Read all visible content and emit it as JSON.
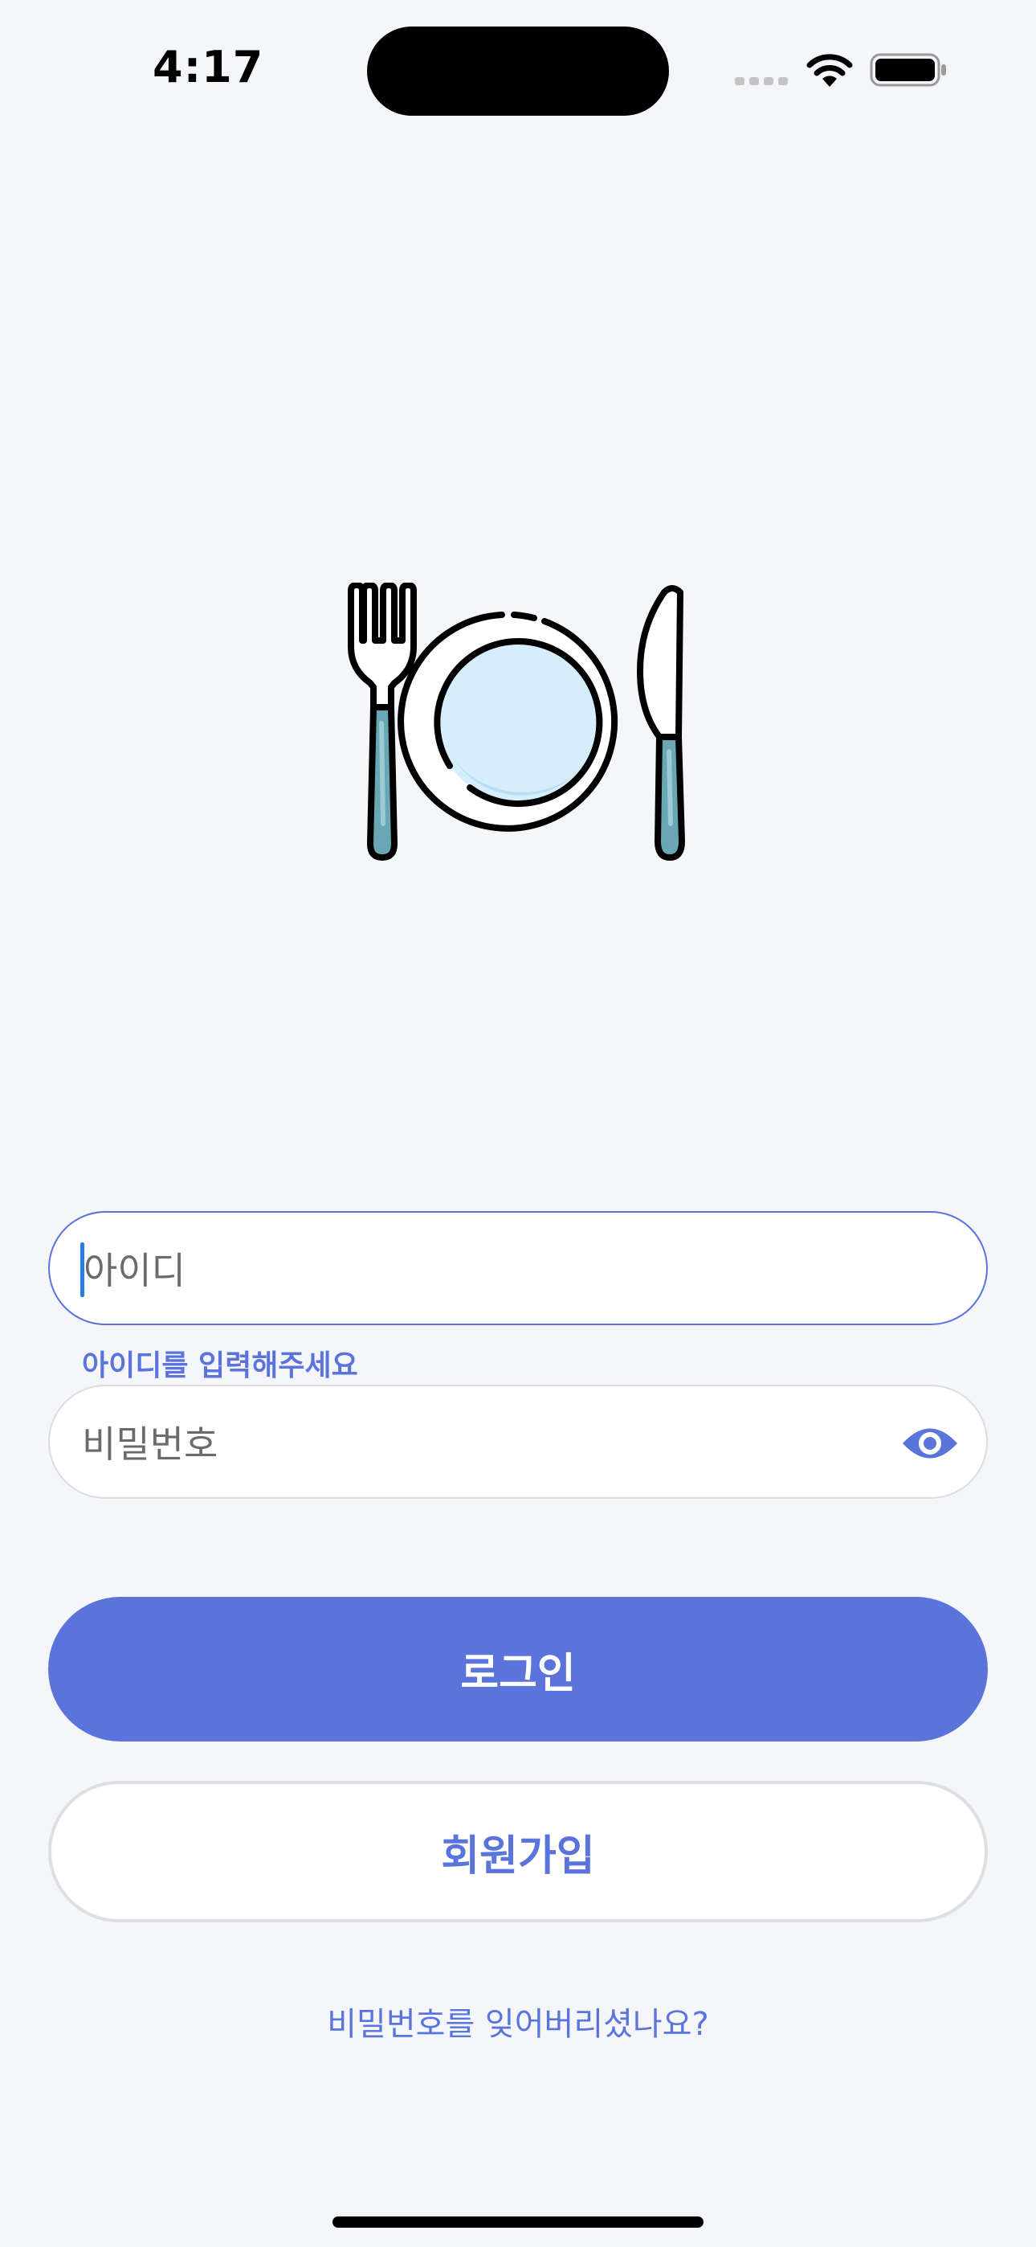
{
  "status_bar": {
    "time": "4:17",
    "icons": [
      "cellular-signal-icon",
      "wifi-icon",
      "battery-icon"
    ]
  },
  "logo": {
    "icon": "fork-plate-knife-icon"
  },
  "login_form": {
    "id_field": {
      "placeholder": "아이디",
      "value": "",
      "helper_text": "아이디를 입력해주세요"
    },
    "password_field": {
      "placeholder": "비밀번호",
      "value": "",
      "toggle_icon": "eye-icon"
    },
    "login_button": "로그인",
    "signup_button": "회원가입",
    "forgot_password_link": "비밀번호를 잊어버리셨나요?"
  },
  "colors": {
    "accent": "#5b74dc",
    "background": "#f5f6fa",
    "plate_fill": "#d6eefb",
    "handle_teal": "#6aa7b4"
  }
}
